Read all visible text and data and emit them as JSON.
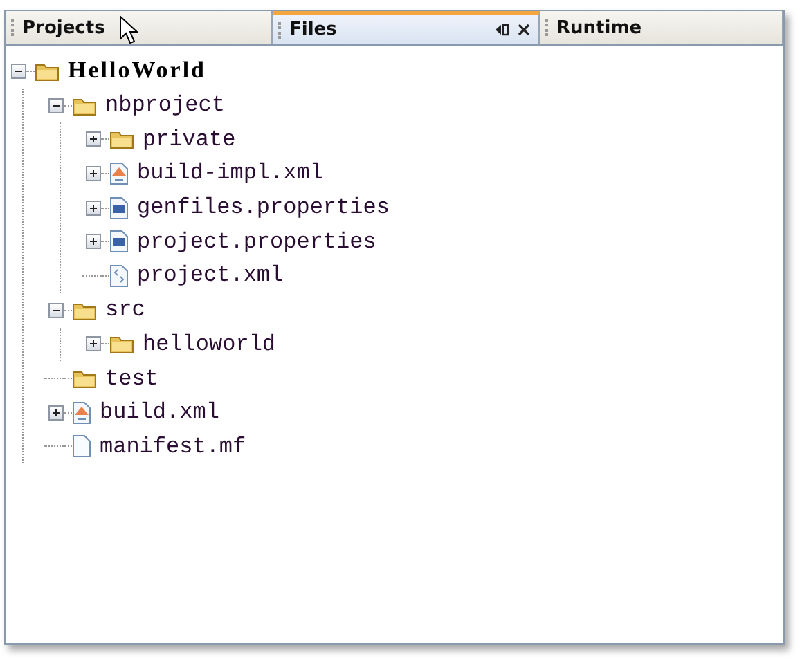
{
  "tabs": [
    {
      "label": "Projects",
      "selected": false
    },
    {
      "label": "Files",
      "selected": true
    },
    {
      "label": "Runtime",
      "selected": false
    }
  ],
  "tree": [
    {
      "label": "HelloWorld",
      "kind": "project",
      "expanded": true,
      "children": [
        {
          "label": "nbproject",
          "kind": "folder",
          "expanded": true,
          "children": [
            {
              "label": "private",
              "kind": "folder",
              "expanded": false
            },
            {
              "label": "build-impl.xml",
              "kind": "ant",
              "expanded": false
            },
            {
              "label": "genfiles.properties",
              "kind": "properties",
              "expanded": false
            },
            {
              "label": "project.properties",
              "kind": "properties",
              "expanded": false
            },
            {
              "label": "project.xml",
              "kind": "xml"
            }
          ]
        },
        {
          "label": "src",
          "kind": "folder",
          "expanded": true,
          "children": [
            {
              "label": "helloworld",
              "kind": "folder",
              "expanded": false
            }
          ]
        },
        {
          "label": "test",
          "kind": "folder"
        },
        {
          "label": "build.xml",
          "kind": "ant",
          "expanded": false
        },
        {
          "label": "manifest.mf",
          "kind": "file"
        }
      ]
    }
  ]
}
